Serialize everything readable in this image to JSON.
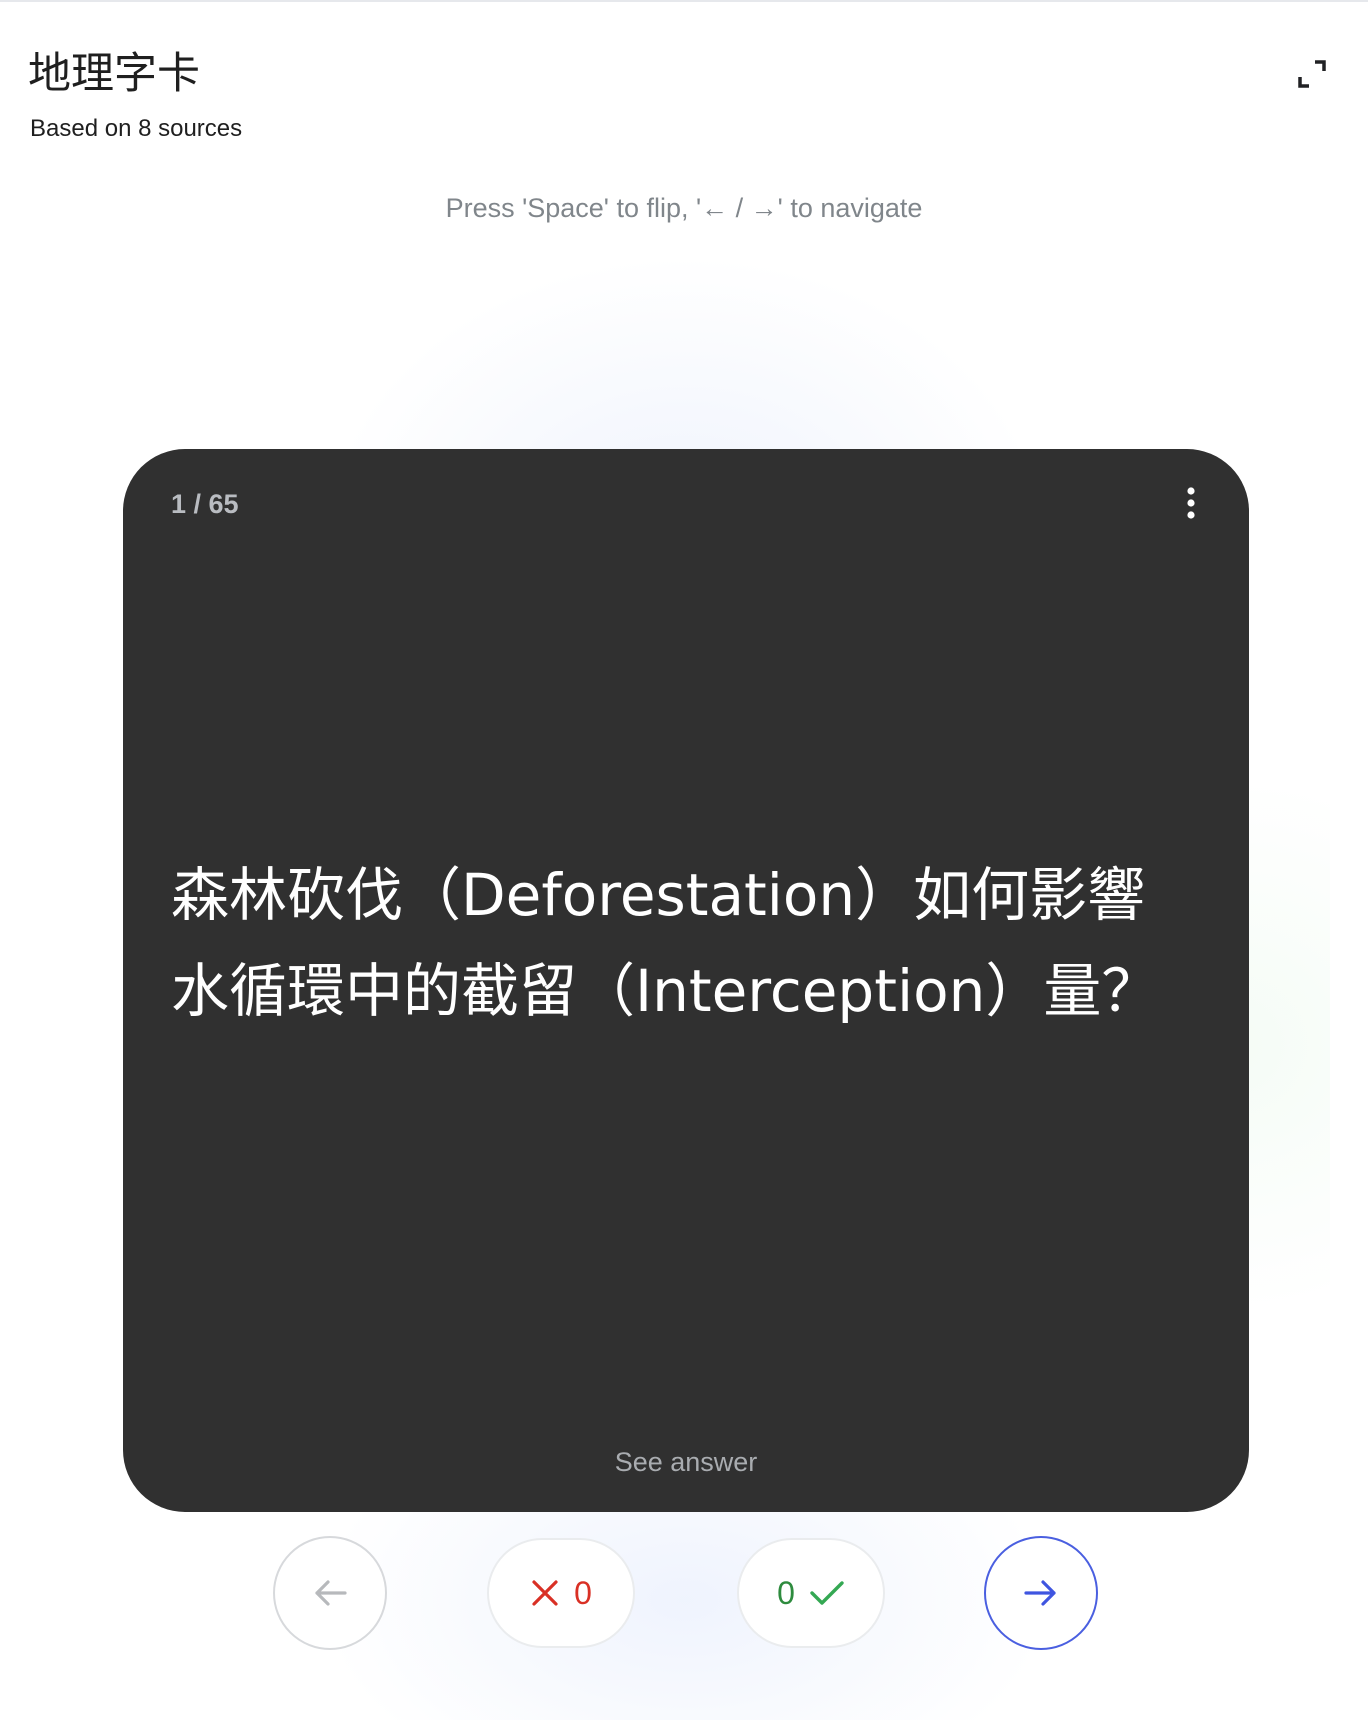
{
  "header": {
    "title": "地理字卡",
    "subtitle": "Based on 8 sources"
  },
  "hint": "Press 'Space' to flip, '← / →' to navigate",
  "card": {
    "counter": "1 / 65",
    "question": "森林砍伐（Deforestation）如何影響水循環中的截留（Interception）量？",
    "see_answer": "See answer"
  },
  "controls": {
    "wrong_count": "0",
    "right_count": "0"
  },
  "icons": {
    "fullscreen": "fullscreen-icon",
    "more": "more-vert-icon",
    "prev": "arrow-left-icon",
    "wrong": "close-icon",
    "right": "check-icon",
    "next": "arrow-right-icon"
  },
  "colors": {
    "card_background": "#303030",
    "wrong": "#d93025",
    "right": "#2e8b3e",
    "next_accent": "#4a5fe0"
  }
}
